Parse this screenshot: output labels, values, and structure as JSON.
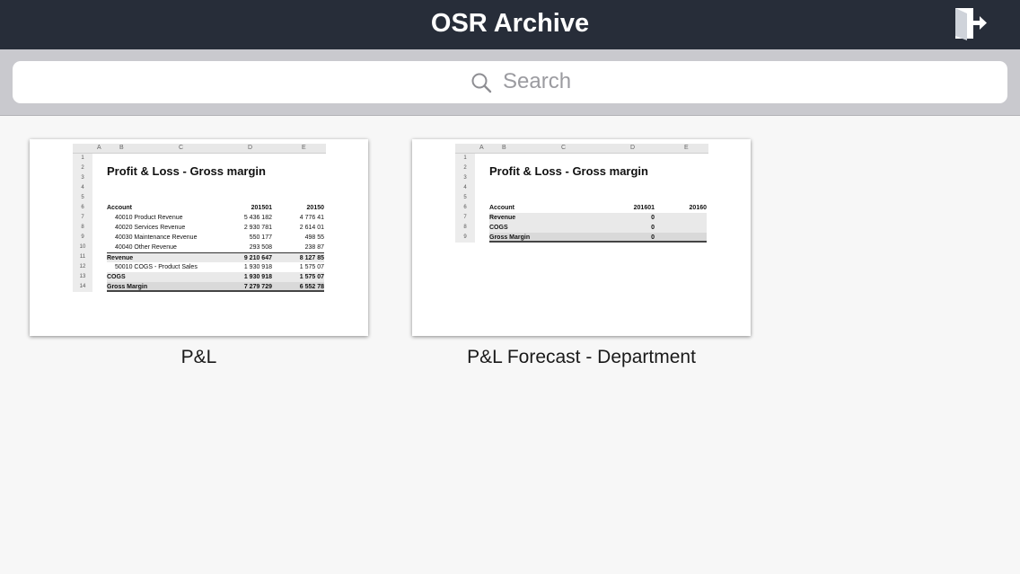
{
  "navbar": {
    "title": "OSR Archive",
    "exit_icon": "exit-door-icon"
  },
  "search": {
    "placeholder": "Search",
    "icon": "search-icon"
  },
  "colors": {
    "navbar_bg": "#272d39",
    "search_bar_bg": "#c9c9ce",
    "page_bg": "#f7f7f7"
  },
  "reports": [
    {
      "caption": "P&L",
      "sheet": {
        "columns": [
          "A",
          "B",
          "C",
          "D",
          "E"
        ],
        "title": "Profit & Loss - Gross margin",
        "header": {
          "label": "Account",
          "v1": "201501",
          "v2": "20150"
        },
        "lines": [
          {
            "label": "40010 Product Revenue",
            "v1": "5 436 182",
            "v2": "4 776 41"
          },
          {
            "label": "40020 Services Revenue",
            "v1": "2 930 781",
            "v2": "2 614 01"
          },
          {
            "label": "40030 Maintenance Revenue",
            "v1": "550 177",
            "v2": "498 55"
          },
          {
            "label": "40040 Other Revenue",
            "v1": "293 508",
            "v2": "238 87"
          },
          {
            "label": "Revenue",
            "v1": "9 210 647",
            "v2": "8 127 85"
          },
          {
            "label": "50010 COGS - Product Sales",
            "v1": "1 930 918",
            "v2": "1 575 07"
          },
          {
            "label": "COGS",
            "v1": "1 930 918",
            "v2": "1 575 07"
          },
          {
            "label": "Gross Margin",
            "v1": "7 279 729",
            "v2": "6 552 78"
          }
        ]
      }
    },
    {
      "caption": "P&L Forecast - Department",
      "sheet": {
        "columns": [
          "A",
          "B",
          "C",
          "D",
          "E"
        ],
        "title": "Profit & Loss - Gross margin",
        "header": {
          "label": "Account",
          "v1": "201601",
          "v2": "20160"
        },
        "lines": [
          {
            "label": "Revenue",
            "v1": "0",
            "v2": ""
          },
          {
            "label": "COGS",
            "v1": "0",
            "v2": ""
          },
          {
            "label": "Gross Margin",
            "v1": "0",
            "v2": ""
          }
        ]
      }
    }
  ]
}
